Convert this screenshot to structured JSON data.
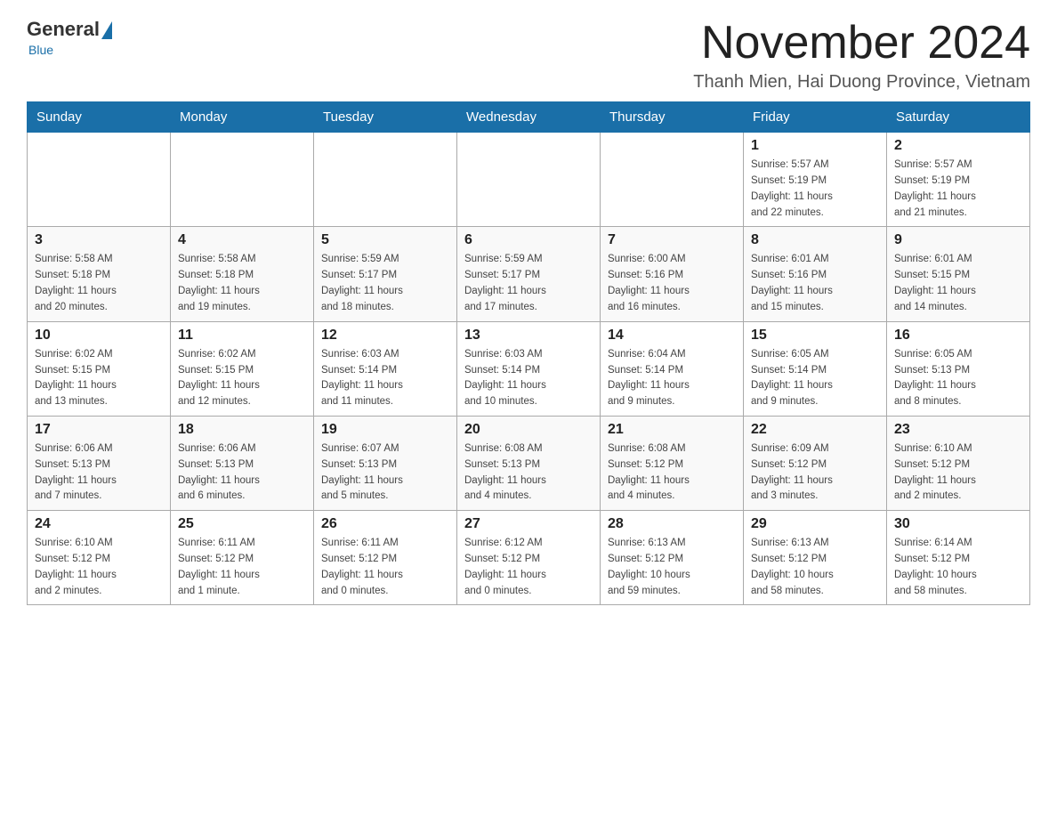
{
  "logo": {
    "general": "General",
    "blue": "Blue",
    "subtitle": "Blue"
  },
  "header": {
    "month": "November 2024",
    "location": "Thanh Mien, Hai Duong Province, Vietnam"
  },
  "weekdays": [
    "Sunday",
    "Monday",
    "Tuesday",
    "Wednesday",
    "Thursday",
    "Friday",
    "Saturday"
  ],
  "weeks": [
    [
      {
        "day": "",
        "info": ""
      },
      {
        "day": "",
        "info": ""
      },
      {
        "day": "",
        "info": ""
      },
      {
        "day": "",
        "info": ""
      },
      {
        "day": "",
        "info": ""
      },
      {
        "day": "1",
        "info": "Sunrise: 5:57 AM\nSunset: 5:19 PM\nDaylight: 11 hours\nand 22 minutes."
      },
      {
        "day": "2",
        "info": "Sunrise: 5:57 AM\nSunset: 5:19 PM\nDaylight: 11 hours\nand 21 minutes."
      }
    ],
    [
      {
        "day": "3",
        "info": "Sunrise: 5:58 AM\nSunset: 5:18 PM\nDaylight: 11 hours\nand 20 minutes."
      },
      {
        "day": "4",
        "info": "Sunrise: 5:58 AM\nSunset: 5:18 PM\nDaylight: 11 hours\nand 19 minutes."
      },
      {
        "day": "5",
        "info": "Sunrise: 5:59 AM\nSunset: 5:17 PM\nDaylight: 11 hours\nand 18 minutes."
      },
      {
        "day": "6",
        "info": "Sunrise: 5:59 AM\nSunset: 5:17 PM\nDaylight: 11 hours\nand 17 minutes."
      },
      {
        "day": "7",
        "info": "Sunrise: 6:00 AM\nSunset: 5:16 PM\nDaylight: 11 hours\nand 16 minutes."
      },
      {
        "day": "8",
        "info": "Sunrise: 6:01 AM\nSunset: 5:16 PM\nDaylight: 11 hours\nand 15 minutes."
      },
      {
        "day": "9",
        "info": "Sunrise: 6:01 AM\nSunset: 5:15 PM\nDaylight: 11 hours\nand 14 minutes."
      }
    ],
    [
      {
        "day": "10",
        "info": "Sunrise: 6:02 AM\nSunset: 5:15 PM\nDaylight: 11 hours\nand 13 minutes."
      },
      {
        "day": "11",
        "info": "Sunrise: 6:02 AM\nSunset: 5:15 PM\nDaylight: 11 hours\nand 12 minutes."
      },
      {
        "day": "12",
        "info": "Sunrise: 6:03 AM\nSunset: 5:14 PM\nDaylight: 11 hours\nand 11 minutes."
      },
      {
        "day": "13",
        "info": "Sunrise: 6:03 AM\nSunset: 5:14 PM\nDaylight: 11 hours\nand 10 minutes."
      },
      {
        "day": "14",
        "info": "Sunrise: 6:04 AM\nSunset: 5:14 PM\nDaylight: 11 hours\nand 9 minutes."
      },
      {
        "day": "15",
        "info": "Sunrise: 6:05 AM\nSunset: 5:14 PM\nDaylight: 11 hours\nand 9 minutes."
      },
      {
        "day": "16",
        "info": "Sunrise: 6:05 AM\nSunset: 5:13 PM\nDaylight: 11 hours\nand 8 minutes."
      }
    ],
    [
      {
        "day": "17",
        "info": "Sunrise: 6:06 AM\nSunset: 5:13 PM\nDaylight: 11 hours\nand 7 minutes."
      },
      {
        "day": "18",
        "info": "Sunrise: 6:06 AM\nSunset: 5:13 PM\nDaylight: 11 hours\nand 6 minutes."
      },
      {
        "day": "19",
        "info": "Sunrise: 6:07 AM\nSunset: 5:13 PM\nDaylight: 11 hours\nand 5 minutes."
      },
      {
        "day": "20",
        "info": "Sunrise: 6:08 AM\nSunset: 5:13 PM\nDaylight: 11 hours\nand 4 minutes."
      },
      {
        "day": "21",
        "info": "Sunrise: 6:08 AM\nSunset: 5:12 PM\nDaylight: 11 hours\nand 4 minutes."
      },
      {
        "day": "22",
        "info": "Sunrise: 6:09 AM\nSunset: 5:12 PM\nDaylight: 11 hours\nand 3 minutes."
      },
      {
        "day": "23",
        "info": "Sunrise: 6:10 AM\nSunset: 5:12 PM\nDaylight: 11 hours\nand 2 minutes."
      }
    ],
    [
      {
        "day": "24",
        "info": "Sunrise: 6:10 AM\nSunset: 5:12 PM\nDaylight: 11 hours\nand 2 minutes."
      },
      {
        "day": "25",
        "info": "Sunrise: 6:11 AM\nSunset: 5:12 PM\nDaylight: 11 hours\nand 1 minute."
      },
      {
        "day": "26",
        "info": "Sunrise: 6:11 AM\nSunset: 5:12 PM\nDaylight: 11 hours\nand 0 minutes."
      },
      {
        "day": "27",
        "info": "Sunrise: 6:12 AM\nSunset: 5:12 PM\nDaylight: 11 hours\nand 0 minutes."
      },
      {
        "day": "28",
        "info": "Sunrise: 6:13 AM\nSunset: 5:12 PM\nDaylight: 10 hours\nand 59 minutes."
      },
      {
        "day": "29",
        "info": "Sunrise: 6:13 AM\nSunset: 5:12 PM\nDaylight: 10 hours\nand 58 minutes."
      },
      {
        "day": "30",
        "info": "Sunrise: 6:14 AM\nSunset: 5:12 PM\nDaylight: 10 hours\nand 58 minutes."
      }
    ]
  ]
}
